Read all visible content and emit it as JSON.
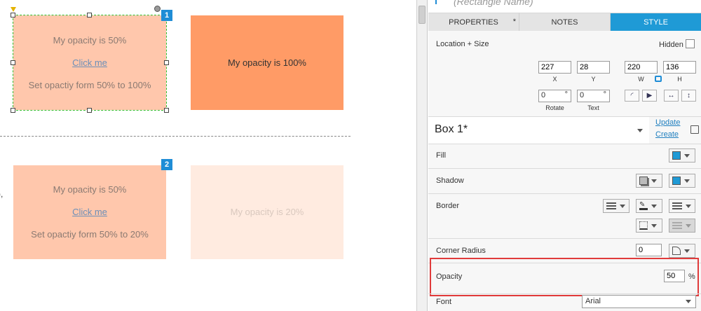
{
  "colors": {
    "accent": "#1f9ad6",
    "box_full": "#ff9b66",
    "box_50": "#ffc7ac",
    "box_20": "#ffebe0",
    "selection": "#2fbf2f",
    "highlight": "#e03b3b"
  },
  "canvas": {
    "box1": {
      "badge": "1",
      "line1": "My opacity is 50%",
      "link": "Click me",
      "line3": "Set opactiy form 50% to 100%"
    },
    "box_full": {
      "text": "My opacity is 100%"
    },
    "box2": {
      "badge": "2",
      "line1": "My opacity is 50%",
      "link": "Click me",
      "line3": "Set opactiy form 50% to 20%"
    },
    "box_20": {
      "text": "My opacity is 20%"
    },
    "stray_mark": "),"
  },
  "panel": {
    "title_placeholder": "(Rectangle Name)",
    "tabs": {
      "properties": "PROPERTIES",
      "properties_marker": "*",
      "notes": "NOTES",
      "style": "STYLE"
    },
    "location_size": {
      "label": "Location + Size",
      "hidden_label": "Hidden",
      "x": "227",
      "x_label": "X",
      "y": "28",
      "y_label": "Y",
      "w": "220",
      "w_label": "W",
      "h": "136",
      "h_label": "H",
      "rotate": "0",
      "rotate_unit": "°",
      "rotate_label": "Rotate",
      "text_rotate": "0",
      "text_rotate_unit": "°",
      "text_label": "Text"
    },
    "style_name": {
      "value": "Box 1*",
      "update_link": "Update",
      "create_link": "Create"
    },
    "fill_label": "Fill",
    "shadow_label": "Shadow",
    "border_label": "Border",
    "corner_radius": {
      "label": "Corner Radius",
      "value": "0"
    },
    "opacity": {
      "label": "Opacity",
      "value": "50",
      "unit": "%"
    },
    "font": {
      "label": "Font",
      "value": "Arial"
    }
  }
}
